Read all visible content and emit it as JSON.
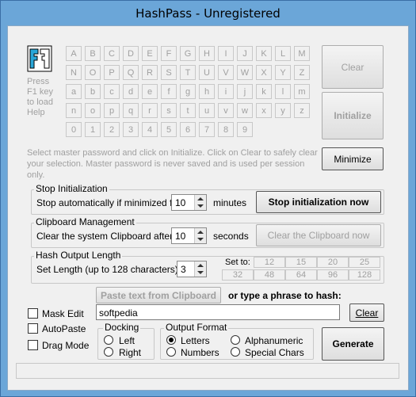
{
  "window": {
    "title": "HashPass - Unregistered"
  },
  "help": {
    "line1": "Press",
    "line2": "F1 key",
    "line3": "to load",
    "line4": "Help"
  },
  "keyboard": {
    "rows": [
      [
        "A",
        "B",
        "C",
        "D",
        "E",
        "F",
        "G",
        "H",
        "I",
        "J",
        "K",
        "L",
        "M"
      ],
      [
        "N",
        "O",
        "P",
        "Q",
        "R",
        "S",
        "T",
        "U",
        "V",
        "W",
        "X",
        "Y",
        "Z"
      ],
      [
        "a",
        "b",
        "c",
        "d",
        "e",
        "f",
        "g",
        "h",
        "i",
        "j",
        "k",
        "l",
        "m"
      ],
      [
        "n",
        "o",
        "p",
        "q",
        "r",
        "s",
        "t",
        "u",
        "v",
        "w",
        "x",
        "y",
        "z"
      ],
      [
        "0",
        "1",
        "2",
        "3",
        "4",
        "5",
        "6",
        "7",
        "8",
        "9"
      ]
    ]
  },
  "buttons": {
    "clear_top": "Clear",
    "initialize": "Initialize",
    "minimize": "Minimize",
    "stop_init": "Stop initialization now",
    "clear_clipboard": "Clear the Clipboard now",
    "paste": "Paste text from Clipboard",
    "clear_phrase": "Clear",
    "generate": "Generate"
  },
  "instructions": "Select master password and click on Initialize. Click on Clear to safely clear your selection. Master password is never saved and is used per session only.",
  "stop_init": {
    "group_title": "Stop Initialization",
    "label": "Stop automatically if minimized for",
    "value": "10",
    "unit": "minutes"
  },
  "clipboard": {
    "group_title": "Clipboard Management",
    "label": "Clear the system Clipboard after",
    "value": "10",
    "unit": "seconds"
  },
  "hash_length": {
    "group_title": "Hash Output Length",
    "label": "Set Length (up to 128 characters):",
    "value": "3",
    "set_to": "Set to:",
    "presets": [
      "12",
      "15",
      "20",
      "25",
      "32",
      "48",
      "64",
      "96",
      "128"
    ]
  },
  "phrase": {
    "or_type": "or type a phrase to hash:",
    "value": "softpedia"
  },
  "options": {
    "mask_edit": "Mask Edit",
    "autopaste": "AutoPaste",
    "drag_mode": "Drag Mode"
  },
  "docking": {
    "group_title": "Docking",
    "left": "Left",
    "right": "Right"
  },
  "output_format": {
    "group_title": "Output Format",
    "letters": "Letters",
    "numbers": "Numbers",
    "alphanumeric": "Alphanumeric",
    "special": "Special Chars",
    "selected": "Letters"
  }
}
